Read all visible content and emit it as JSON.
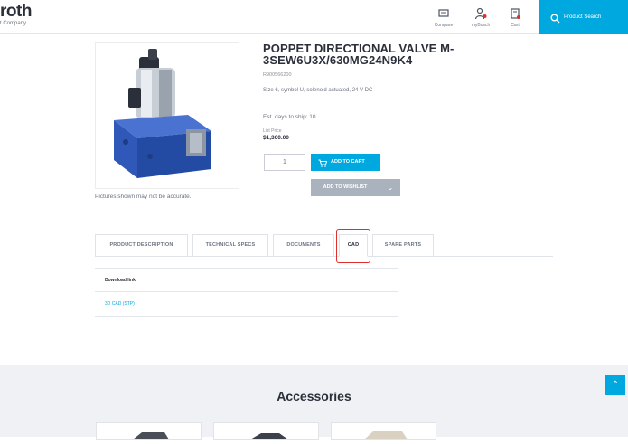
{
  "header": {
    "logo_text": "roth",
    "logo_sub": "t Company",
    "compare_label": "Compare",
    "mybutton_label": "myBosch",
    "cart_label": "Cart",
    "search_label": "Product Search"
  },
  "product": {
    "title": "POPPET DIRECTIONAL VALVE M-3SEW6U3X/630MG24N9K4",
    "part_number": "R900566200",
    "description": "Size 6, symbol U, solenoid actuated, 24 V DC",
    "ship_text": "Est. days to ship: 10",
    "price_label": "List Price",
    "price": "$1,360.00",
    "quantity": "1",
    "add_to_cart": "ADD TO CART",
    "add_to_wishlist": "ADD TO WISHLIST",
    "image_note": "Pictures shown may not be accurate."
  },
  "tabs": [
    {
      "label": "PRODUCT DESCRIPTION"
    },
    {
      "label": "TECHNICAL SPECS"
    },
    {
      "label": "DOCUMENTS"
    },
    {
      "label": "CAD"
    },
    {
      "label": "SPARE PARTS"
    }
  ],
  "cad": {
    "header": "Download link",
    "link": "3D CAD (STP)"
  },
  "accessories": {
    "title": "Accessories"
  },
  "colors": {
    "accent": "#00a8e0",
    "highlight": "#e0302b",
    "valve_body": "#2f58b8"
  }
}
